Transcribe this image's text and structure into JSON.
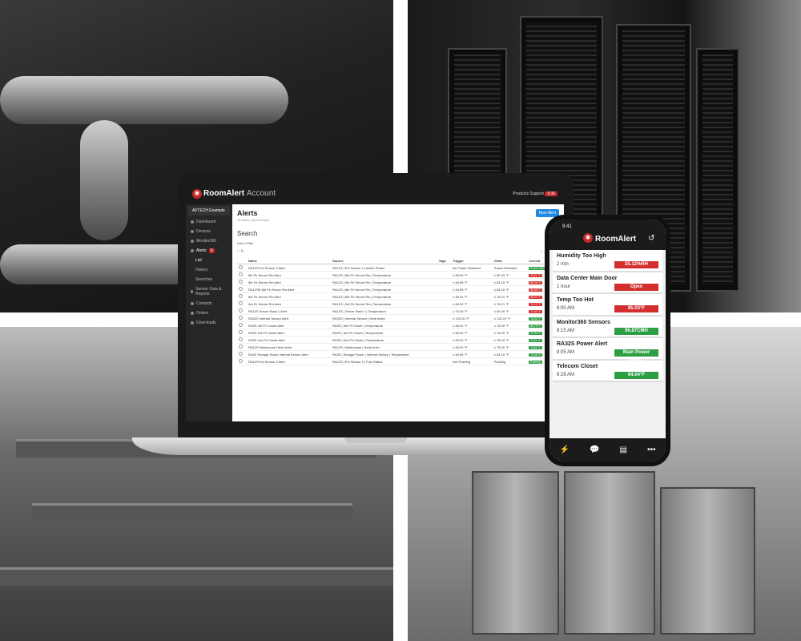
{
  "laptop": {
    "app": {
      "brand": "RoomAlert",
      "brand_sub": "Account",
      "header_products": "Products",
      "header_support": "Support",
      "header_badge": "9:36"
    },
    "sidebar": {
      "org": "AVTECH Example",
      "items": [
        {
          "label": "Dashboard"
        },
        {
          "label": "Devices"
        },
        {
          "label": "Monitor360"
        },
        {
          "label": "Alerts",
          "badge": "9"
        },
        {
          "label": "List"
        },
        {
          "label": "History"
        },
        {
          "label": "Searches"
        },
        {
          "label": "Sensor Data & Reports"
        },
        {
          "label": "Contacts"
        },
        {
          "label": "Orders"
        },
        {
          "label": "Downloads"
        }
      ]
    },
    "page": {
      "title": "Alerts",
      "subtitle": "15 alerts, all 15 shown",
      "new_button": "New Alert",
      "search_title": "Search",
      "add_filter": "Add a Filter",
      "pager": "1 – 14 of 14"
    },
    "table": {
      "headers": [
        "Name",
        "Source",
        "Tags",
        "Trigger",
        "Clear",
        "Current"
      ],
      "rows": [
        [
          "RA12S Ext Sensor 2 Alert",
          "RA12S | Ext Sensor 2 | Active Power",
          "",
          "No Power Detected",
          "Power Detected",
          "Power Detected",
          "green"
        ],
        [
          "5th Flr Server Rm Alert",
          "RA12S | 5th Flr Server Rm | Temperature",
          "",
          "≥ 80.00 °F",
          "≤ 80.29 °F",
          "78.21 °F",
          "red"
        ],
        [
          "5th Flr Server Rm Alert",
          "RA12S | 5th Flr Server Rm | Temperature",
          "",
          "≥ 84.98 °F",
          "≤ 83.15 °F",
          "80.06 °F",
          "red"
        ],
        [
          "RA12SR 6th Flr Server Rm Alert",
          "RA12S | 6th Flr Server Rm | Temperature",
          "",
          "≥ 84.98 °F",
          "≤ 83.16 °F",
          "80.98 °F",
          "red"
        ],
        [
          "6th Flr Server Rm Alert",
          "RA12S | 6th Flr Server Rm | Temperature",
          "",
          "≥ 80.01 °F",
          "≤ 78.21 °F",
          "80.21 °F",
          "red"
        ],
        [
          "3rd Flr Server Rm Alert",
          "RA12S | 3rd Flr Server Rm | Temperature",
          "",
          "≥ 80.00 °F",
          "≤ 78.21 °F",
          "79.12 °F",
          "red"
        ],
        [
          "RA12S Server Rack 1 Alert",
          "RA12S | Server Rack 1 | Temperature",
          "",
          "≥ 70.00 °F",
          "≤ 69.29 °F",
          "71.63 °F",
          "red"
        ],
        [
          "RA32S Internal Sensor Alert",
          "RA32S | Internal Sensor | Heat Index",
          "",
          "≥ 120.00 °F",
          "≤ 119.20 °F",
          "78.00 °F",
          "green"
        ],
        [
          "RA3S 4th Flr Closet Alert",
          "RA3S | 4th Flr Closet | Temperature",
          "",
          "≥ 80.00 °F",
          "≤ 78.20 °F",
          "69.75 °F",
          "green"
        ],
        [
          "RA3S 3rd Flr Closet Alert",
          "RA3S | 3rd Flr Closet | Temperature",
          "",
          "≥ 80.00 °F",
          "≤ 78.20 °F",
          "71.94 °F",
          "green"
        ],
        [
          "RA3S 2nd Flr Closet Alert",
          "RA3S | 2nd Flr Closet | Temperature",
          "",
          "≥ 80.00 °F",
          "≤ 78.20 °F",
          "74.21 °F",
          "green"
        ],
        [
          "RA12S Warehouse Heat Index",
          "RA12S | Warehouse | Heat Index",
          "",
          "≥ 80.00 °F",
          "≤ 78.20 °F",
          "75.60 °F",
          "green"
        ],
        [
          "RA3S Storage Room Internal Sensor Alert",
          "RA3S | Storage Room | Internal Sensor | Temperature",
          "",
          "≥ 84.98 °F",
          "≤ 83.16 °F",
          "73.28 °F",
          "green"
        ],
        [
          "RA12S Ext Sensor 2 Alert",
          "RA12S | Ext Sensor 2 | Fuel Status",
          "",
          "Not Pushing",
          "Pushing",
          "Pushing",
          "green"
        ]
      ]
    }
  },
  "phone": {
    "time": "9:41",
    "brand": "RoomAlert",
    "alerts": [
      {
        "name": "Humidity Too High",
        "time": "2 min",
        "value": "25.12%RH",
        "status": "red"
      },
      {
        "name": "Data Center Main Door",
        "time": "1 hour",
        "value": "Open",
        "status": "red"
      },
      {
        "name": "Temp Too Hot",
        "time": "8:00 AM",
        "value": "85.03°F",
        "status": "red"
      },
      {
        "name": "Monitor360 Sensors",
        "time": "8:15 AM",
        "value": "96.87CMH",
        "status": "green"
      },
      {
        "name": "RA32S Power Alert",
        "time": "8:05 AM",
        "value": "Main Power Detec...",
        "status": "green"
      },
      {
        "name": "Telecom Closet",
        "time": "8:28 AM",
        "value": "64.04°F",
        "status": "green"
      }
    ]
  },
  "colors": {
    "accent": "#c62828",
    "ok": "#2e9e44",
    "alarm": "#d32f2f",
    "button": "#1e88e5"
  }
}
